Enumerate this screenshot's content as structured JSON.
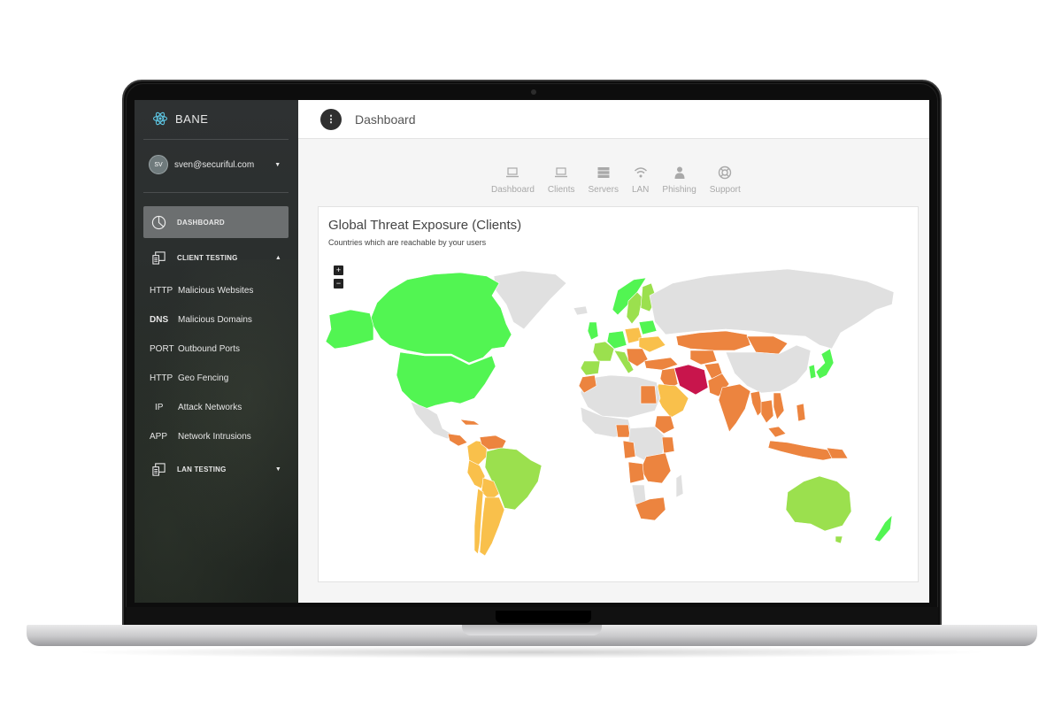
{
  "app": {
    "name": "BANE"
  },
  "user": {
    "initials": "SV",
    "email": "sven@securiful.com"
  },
  "sidebar": {
    "dashboard_label": "DASHBOARD",
    "client_testing_label": "CLIENT TESTING",
    "lan_testing_label": "LAN TESTING",
    "sub_items": [
      {
        "prefix": "HTTP",
        "label": "Malicious Websites"
      },
      {
        "prefix": "DNS",
        "label": "Malicious Domains"
      },
      {
        "prefix": "PORT",
        "label": "Outbound Ports"
      },
      {
        "prefix": "HTTP",
        "label": "Geo Fencing"
      },
      {
        "prefix": "IP",
        "label": "Attack Networks"
      },
      {
        "prefix": "APP",
        "label": "Network Intrusions"
      }
    ]
  },
  "header": {
    "menu_icon": "more-vert-icon",
    "title": "Dashboard"
  },
  "tabs": [
    {
      "label": "Dashboard",
      "icon": "laptop-icon"
    },
    {
      "label": "Clients",
      "icon": "laptop-icon"
    },
    {
      "label": "Servers",
      "icon": "server-icon"
    },
    {
      "label": "LAN",
      "icon": "wifi-icon"
    },
    {
      "label": "Phishing",
      "icon": "person-icon"
    },
    {
      "label": "Support",
      "icon": "lifebuoy-icon"
    }
  ],
  "card": {
    "title": "Global Threat Exposure (Clients)",
    "subtitle": "Countries which are reachable by your users",
    "zoom_in": "+",
    "zoom_out": "−"
  },
  "colors": {
    "no_data": "#e0e0e0",
    "green": "#52f552",
    "light_green": "#9be04e",
    "yellow": "#f9c04b",
    "orange": "#ec843f",
    "red": "#c8154c"
  }
}
